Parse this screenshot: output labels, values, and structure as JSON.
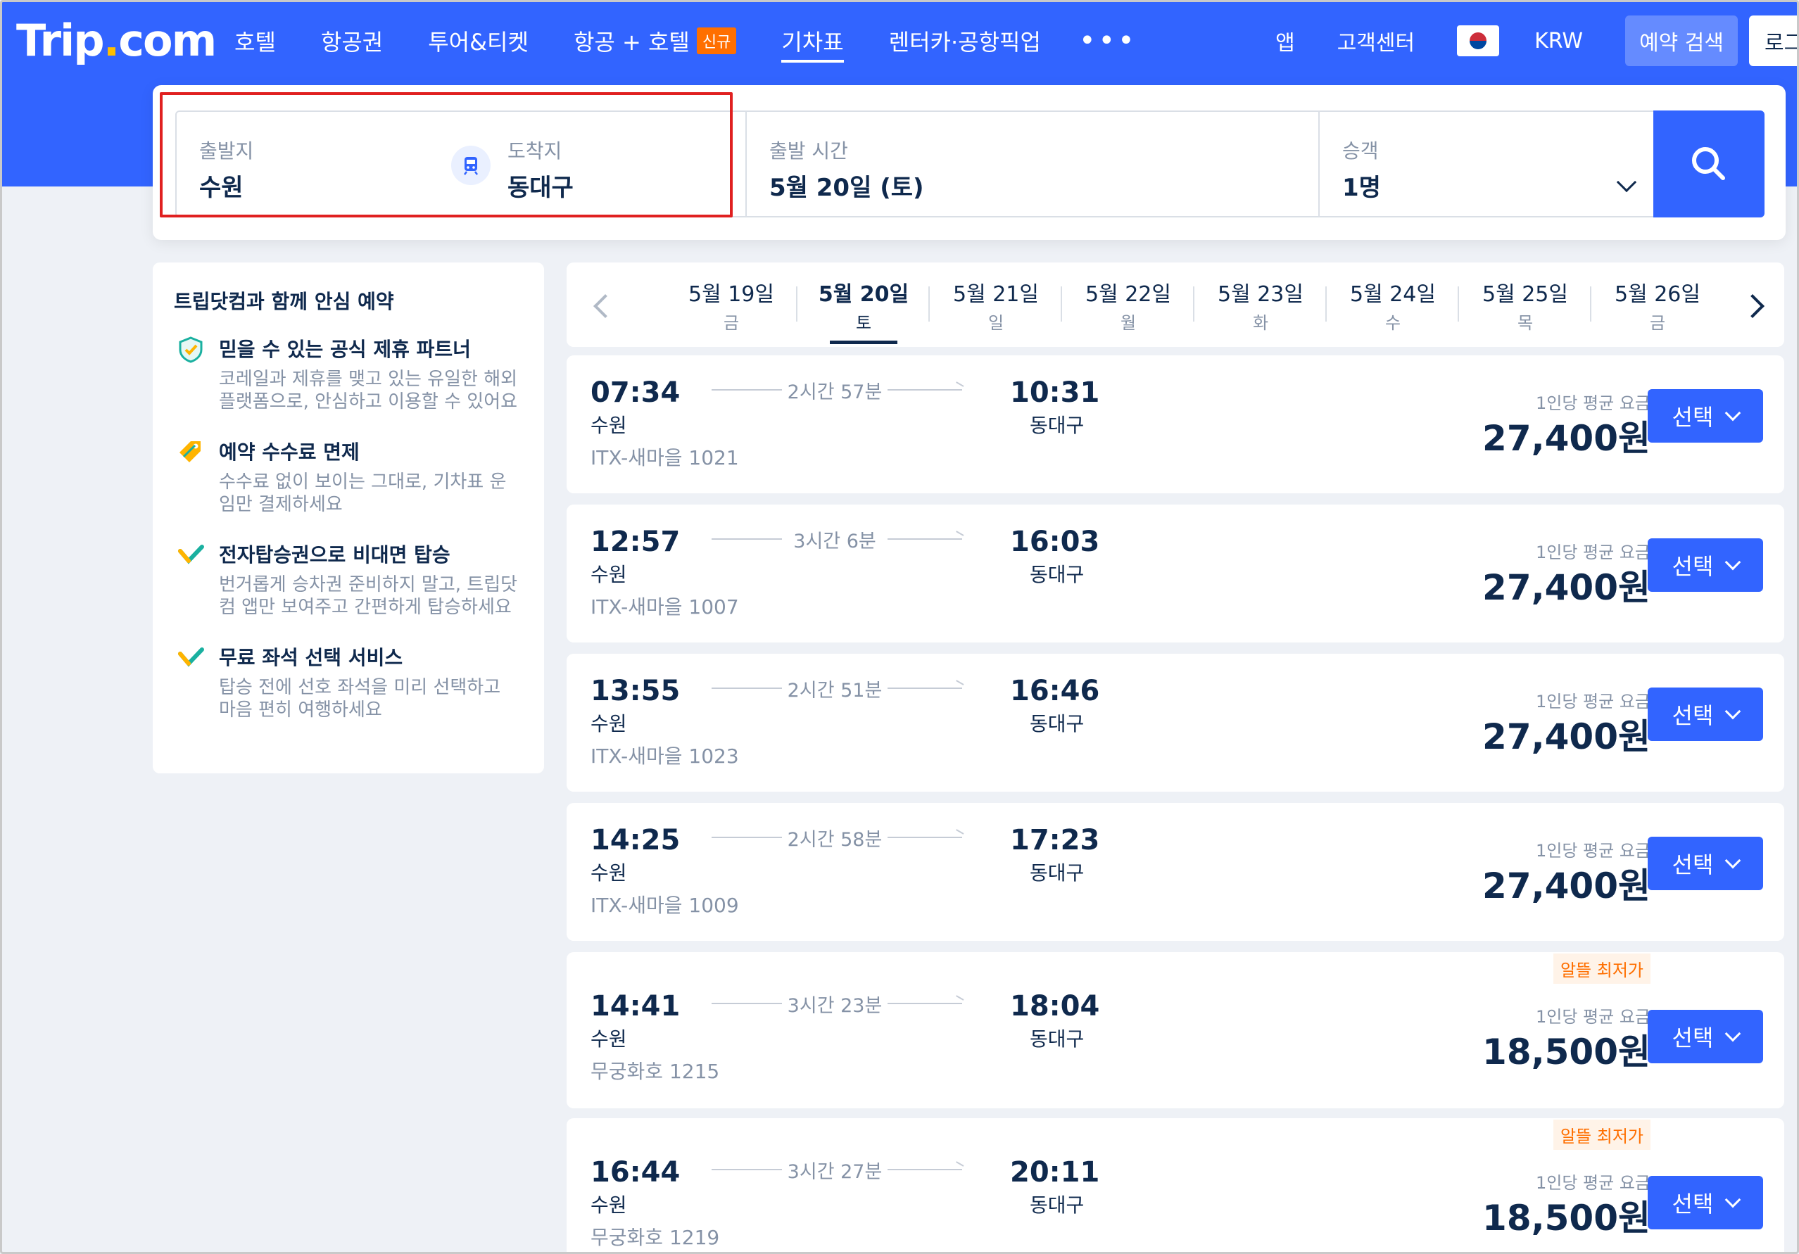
{
  "brand": {
    "logo_prefix": "Trip",
    "logo_dot": ".",
    "logo_suffix": "com"
  },
  "nav": {
    "items": [
      {
        "label": "호텔"
      },
      {
        "label": "항공권"
      },
      {
        "label": "투어&티켓"
      },
      {
        "label": "항공 + 호텔",
        "badge": "신규"
      },
      {
        "label": "기차표"
      },
      {
        "label": "렌터카·공항픽업"
      }
    ],
    "more": "•••",
    "app": "앱",
    "support": "고객센터",
    "currency": "KRW",
    "booking": "예약 검색",
    "login": "로그인"
  },
  "search": {
    "from_label": "출발지",
    "from_value": "수원",
    "to_label": "도착지",
    "to_value": "동대구",
    "date_label": "출발 시간",
    "date_value": "5월 20일 (토)",
    "pax_label": "승객",
    "pax_value": "1명"
  },
  "sidebar": {
    "title": "트립닷컴과 함께 안심 예약",
    "items": [
      {
        "title": "믿을 수 있는 공식 제휴 파트너",
        "desc": "코레일과 제휴를 맺고 있는 유일한 해외 플랫폼으로, 안심하고 이용할 수 있어요"
      },
      {
        "title": "예약 수수료 면제",
        "desc": "수수료 없이 보이는 그대로, 기차표 운임만 결제하세요"
      },
      {
        "title": "전자탑승권으로 비대면 탑승",
        "desc": "번거롭게 승차권 준비하지 말고, 트립닷컴 앱만 보여주고 간편하게 탑승하세요"
      },
      {
        "title": "무료 좌석 선택 서비스",
        "desc": "탑승 전에 선호 좌석을 미리 선택하고 마음 편히 여행하세요"
      }
    ]
  },
  "dates": [
    {
      "date": "5월 19일",
      "weekday": "금"
    },
    {
      "date": "5월 20일",
      "weekday": "토",
      "active": true
    },
    {
      "date": "5월 21일",
      "weekday": "일"
    },
    {
      "date": "5월 22일",
      "weekday": "월"
    },
    {
      "date": "5월 23일",
      "weekday": "화"
    },
    {
      "date": "5월 24일",
      "weekday": "수"
    },
    {
      "date": "5월 25일",
      "weekday": "목"
    },
    {
      "date": "5월 26일",
      "weekday": "금"
    }
  ],
  "trains": [
    {
      "dep": "07:34",
      "from": "수원",
      "dur": "2시간 57분",
      "arr": "10:31",
      "to": "동대구",
      "name": "ITX-새마을 1021",
      "per": "1인당 평균 요금",
      "price": "27,400원",
      "badge": ""
    },
    {
      "dep": "12:57",
      "from": "수원",
      "dur": "3시간 6분",
      "arr": "16:03",
      "to": "동대구",
      "name": "ITX-새마을 1007",
      "per": "1인당 평균 요금",
      "price": "27,400원",
      "badge": ""
    },
    {
      "dep": "13:55",
      "from": "수원",
      "dur": "2시간 51분",
      "arr": "16:46",
      "to": "동대구",
      "name": "ITX-새마을 1023",
      "per": "1인당 평균 요금",
      "price": "27,400원",
      "badge": ""
    },
    {
      "dep": "14:25",
      "from": "수원",
      "dur": "2시간 58분",
      "arr": "17:23",
      "to": "동대구",
      "name": "ITX-새마을 1009",
      "per": "1인당 평균 요금",
      "price": "27,400원",
      "badge": ""
    },
    {
      "dep": "14:41",
      "from": "수원",
      "dur": "3시간 23분",
      "arr": "18:04",
      "to": "동대구",
      "name": "무궁화호 1215",
      "per": "1인당 평균 요금",
      "price": "18,500원",
      "badge": "알뜰 최저가"
    },
    {
      "dep": "16:44",
      "from": "수원",
      "dur": "3시간 27분",
      "arr": "20:11",
      "to": "동대구",
      "name": "무궁화호 1219",
      "per": "1인당 평균 요금",
      "price": "18,500원",
      "badge": "알뜰 최저가"
    }
  ],
  "select_label": "선택",
  "colors": {
    "primary": "#3264ff",
    "text": "#0f294d",
    "muted": "#8592a6",
    "badge": "#ff6f00",
    "highlight": "#e02020"
  }
}
